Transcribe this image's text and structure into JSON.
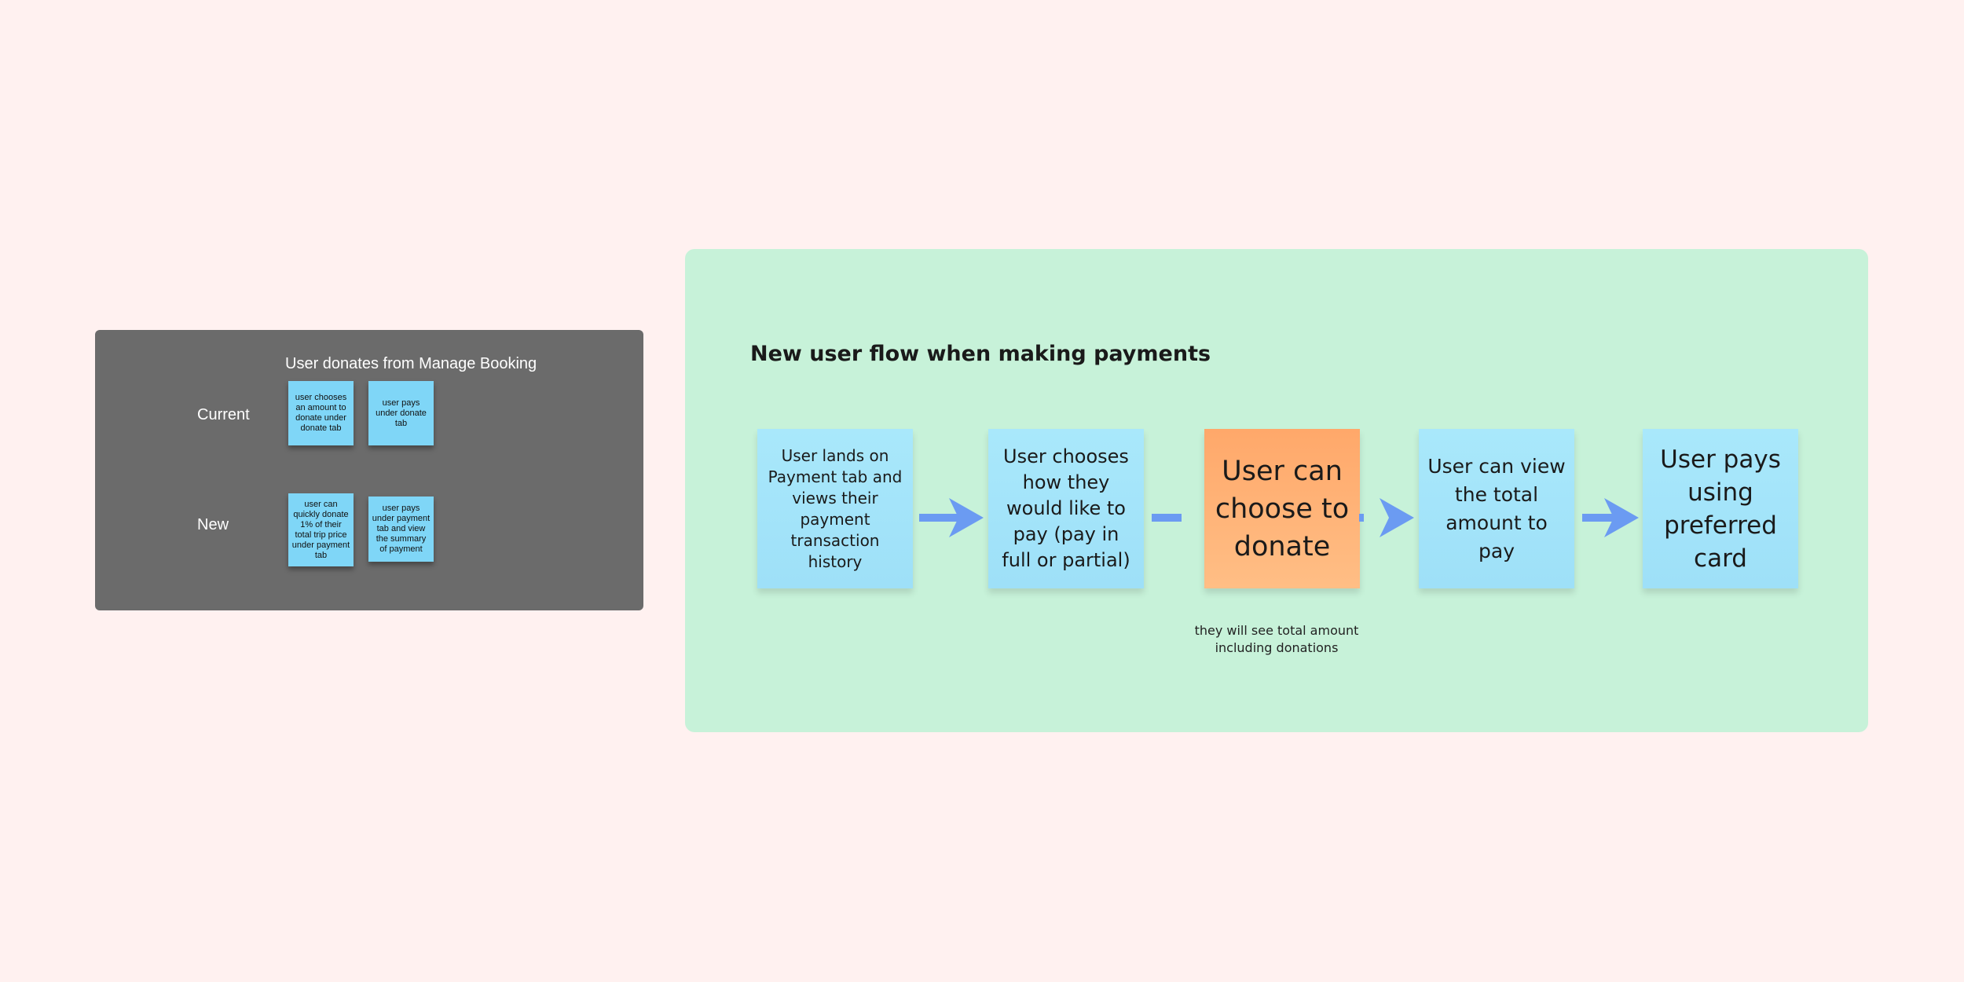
{
  "left_panel": {
    "title": "User donates from Manage Booking",
    "rows": [
      {
        "label": "Current",
        "notes": [
          "user chooses an amount to donate under donate tab",
          "user pays under donate tab"
        ]
      },
      {
        "label": "New",
        "notes": [
          "user can quickly donate 1% of their total trip price under payment tab",
          "user pays under payment tab and view the summary of payment"
        ]
      }
    ]
  },
  "flow": {
    "title": "New user flow when making payments",
    "steps": [
      "User lands on Payment tab and views their payment transaction history",
      "User chooses how they would like to pay (pay in full or partial)",
      "User can choose to donate",
      "User can view the total amount to pay",
      "User pays using preferred card"
    ],
    "donate_note": "they will see total amount including donations"
  },
  "colors": {
    "background": "#fff1f0",
    "dark_frame": "#6b6b6b",
    "green_frame": "#c7f2d9",
    "sticky_blue": "#a9e8fb",
    "sticky_orange": "#ffa86a",
    "arrow": "#6b9bf2"
  }
}
